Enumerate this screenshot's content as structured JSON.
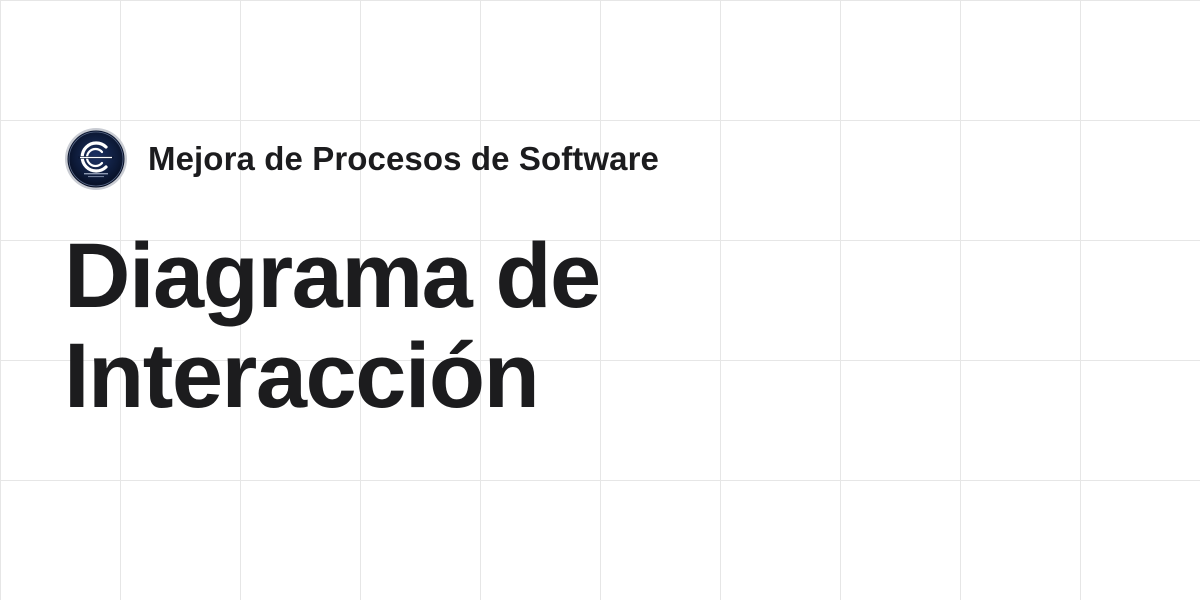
{
  "header": {
    "logo_icon": "circular-c-logo-icon",
    "site_name": "Mejora de Procesos de Software"
  },
  "page": {
    "title_line_1": "Diagrama de",
    "title_line_2": "Interacción"
  },
  "colors": {
    "text": "#1c1c1e",
    "background": "#ffffff",
    "grid": "#e6e6e6",
    "logo_background": "#0f1c3a",
    "logo_ring": "#c9ccd3"
  }
}
